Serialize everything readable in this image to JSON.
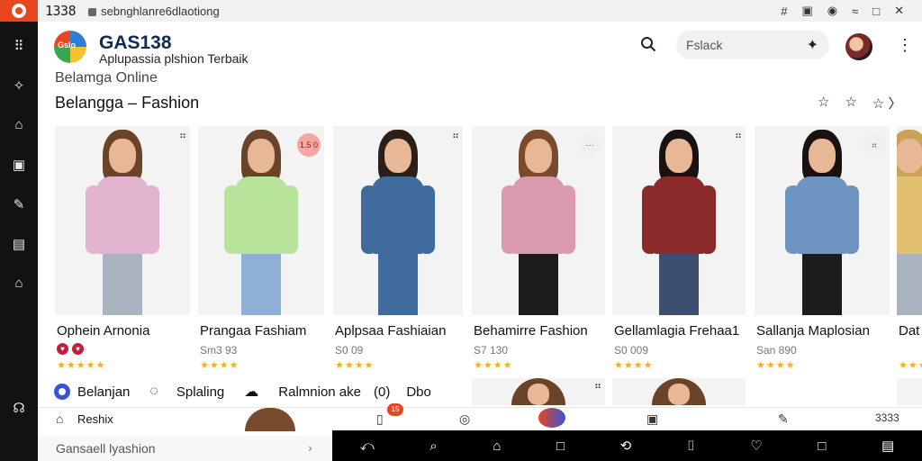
{
  "status": {
    "time": "1338",
    "url": "sebnghlanre6dlaotiong",
    "icons": [
      "#",
      "▣",
      "◉",
      "≈",
      "□",
      "✕"
    ]
  },
  "rail": {
    "icons": [
      "grid-icon",
      "star-icon",
      "bag-icon",
      "image-icon",
      "brush-icon",
      "note-icon",
      "home-icon",
      "headset-icon"
    ]
  },
  "header": {
    "brand_name": "GAS138",
    "tagline": "Aplupassia plshion Terbaik",
    "subtitle": "Belamga Online",
    "page_title": "Belangga – Fashion",
    "search_placeholder": "Fslack",
    "title_actions": [
      "☆",
      "☆",
      "☆ 〉"
    ]
  },
  "products": [
    {
      "name": "Ophein Arnonia",
      "price": "",
      "stars": "★★★★★",
      "hearts": [
        "♥",
        "♥"
      ],
      "badge": "⠶",
      "colors": {
        "top": "#e3b4d0",
        "hair": "#6b4328",
        "legs": "#aab3c0"
      }
    },
    {
      "name": "Prangaa Fashiam",
      "price": "Sm3 93",
      "stars": "★★★★",
      "badge_round": "1.5 0",
      "colors": {
        "top": "#b7e39a",
        "hair": "#6b4328",
        "legs": "#8fb0d6"
      }
    },
    {
      "name": "Aplpsaa Fashiaian",
      "price": "S0 09",
      "stars": "★★★★",
      "badge": "⠶",
      "colors": {
        "top": "#3f6c9c",
        "hair": "#2d1f17",
        "legs": "#3f6c9c"
      }
    },
    {
      "name": "Behamirre Fashion",
      "price": "S7 130",
      "stars": "★★★★",
      "badge_round": "···",
      "colors": {
        "top": "#d99aae",
        "hair": "#7a4a2c",
        "legs": "#1c1c1c"
      }
    },
    {
      "name": "Gellamlagia Frehaa1",
      "price": "S0 009",
      "stars": "★★★★",
      "badge": "⠶",
      "colors": {
        "top": "#8a2a2a",
        "hair": "#1a1211",
        "legs": "#3c4f6e"
      }
    },
    {
      "name": "Sallanja Maplosian",
      "price": "San 890",
      "stars": "★★★★",
      "badge_round": "⠶",
      "colors": {
        "top": "#6e94c2",
        "hair": "#1a1211",
        "legs": "#1c1c1c"
      }
    },
    {
      "name": "Dat",
      "price": "",
      "stars": "★★★",
      "colors": {
        "top": "#e0c070",
        "hair": "#c9a25a",
        "legs": "#aab3c0"
      }
    }
  ],
  "tabs": [
    {
      "label": "Belanjan"
    },
    {
      "label": "Splaling"
    },
    {
      "label": "Ralmnion ake"
    },
    {
      "label": "(0)"
    },
    {
      "label": "Dbo"
    }
  ],
  "row2": {
    "label": "Reshix",
    "badge": "15",
    "count": "3333"
  },
  "footer": {
    "label": "Gansaell lyashion"
  }
}
